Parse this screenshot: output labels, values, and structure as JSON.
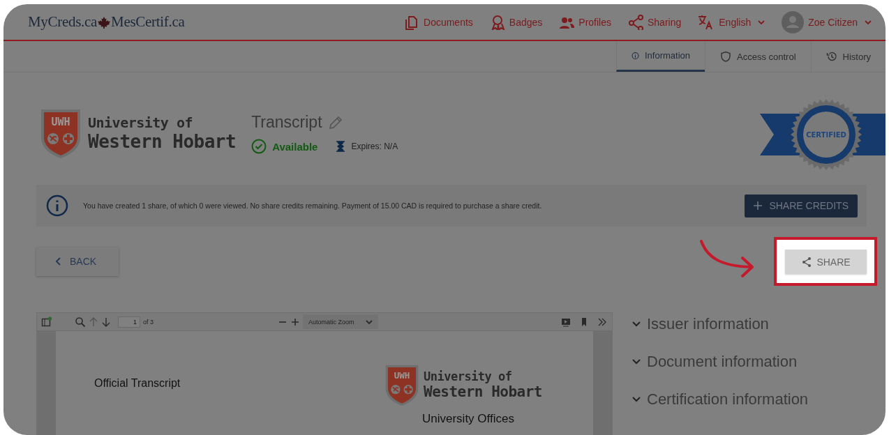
{
  "header": {
    "logo_left": "MyCreds.ca",
    "logo_right": "MesCertif.ca",
    "nav": [
      {
        "kind": "documents",
        "label": "Documents"
      },
      {
        "kind": "badges",
        "label": "Badges"
      },
      {
        "kind": "profiles",
        "label": "Profiles"
      },
      {
        "kind": "sharing",
        "label": "Sharing"
      }
    ],
    "language": "English",
    "user": "Zoe Citizen"
  },
  "tabs": [
    {
      "kind": "info",
      "label": "Information",
      "selected": true
    },
    {
      "kind": "shield",
      "label": "Access control",
      "selected": false
    },
    {
      "kind": "history",
      "label": "History",
      "selected": false
    }
  ],
  "document": {
    "logo_mark": "UWH",
    "issuer_line1": "University of",
    "issuer_line2": "Western Hobart",
    "title": "Transcript",
    "status": "Available",
    "expires": "Expires: N/A",
    "seal": "CERTIFIED"
  },
  "notice": {
    "text": "You have created 1 share, of which 0 were viewed. No share credits remaining. Payment of 15.00 CAD is required to purchase a share credit.",
    "button": "SHARE CREDITS"
  },
  "actions": {
    "back": "BACK",
    "share": "SHARE",
    "share_highlighted": true
  },
  "viewer": {
    "page": "1",
    "page_count": "of 3",
    "zoom": "Automatic Zoom",
    "content": {
      "heading": "Official Transcript",
      "logo_mark": "UWH",
      "issuer_line1": "University of",
      "issuer_line2": "Western Hobart",
      "office": "University Offices"
    }
  },
  "accordion": [
    {
      "label": "Issuer information"
    },
    {
      "label": "Document information"
    },
    {
      "label": "Certification information"
    }
  ]
}
